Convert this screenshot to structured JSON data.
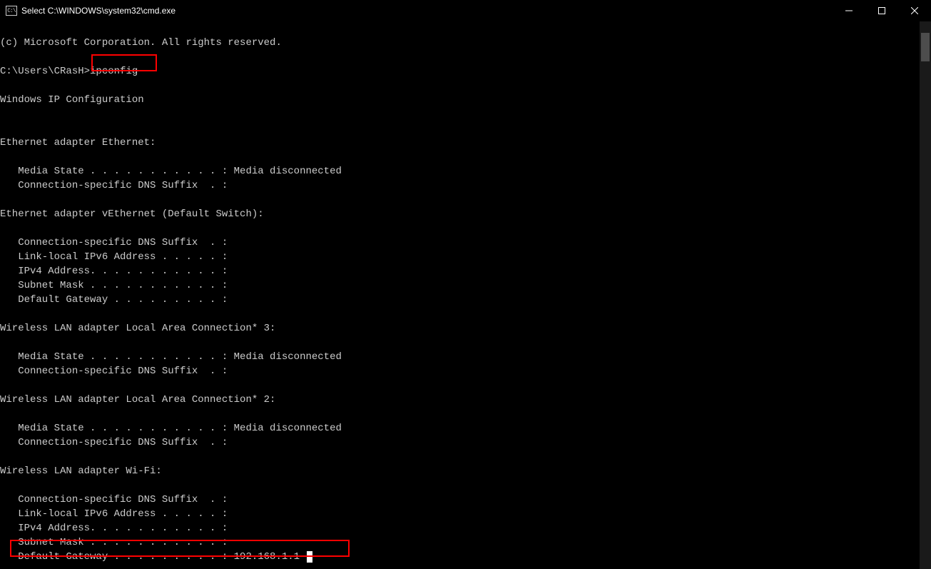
{
  "window": {
    "title": "Select C:\\WINDOWS\\system32\\cmd.exe",
    "icon_label": "C:\\"
  },
  "term": {
    "copyright": "(c) Microsoft Corporation. All rights reserved.",
    "prompt": "C:\\Users\\CRasH>",
    "command": "ipconfig",
    "header": "Windows IP Configuration",
    "eth_title": "Ethernet adapter Ethernet:",
    "media_state": "   Media State . . . . . . . . . . . : Media disconnected",
    "conn_suffix": "   Connection-specific DNS Suffix  . :",
    "veth_title": "Ethernet adapter vEthernet (Default Switch):",
    "link_local": "   Link-local IPv6 Address . . . . . :",
    "ipv4": "   IPv4 Address. . . . . . . . . . . :",
    "subnet": "   Subnet Mask . . . . . . . . . . . :",
    "default_gw_blank": "   Default Gateway . . . . . . . . . :",
    "wlan3_title": "Wireless LAN adapter Local Area Connection* 3:",
    "wlan2_title": "Wireless LAN adapter Local Area Connection* 2:",
    "wifi_title": "Wireless LAN adapter Wi-Fi:",
    "default_gw_value": "   Default Gateway . . . . . . . . . : 192.168.1.1"
  }
}
